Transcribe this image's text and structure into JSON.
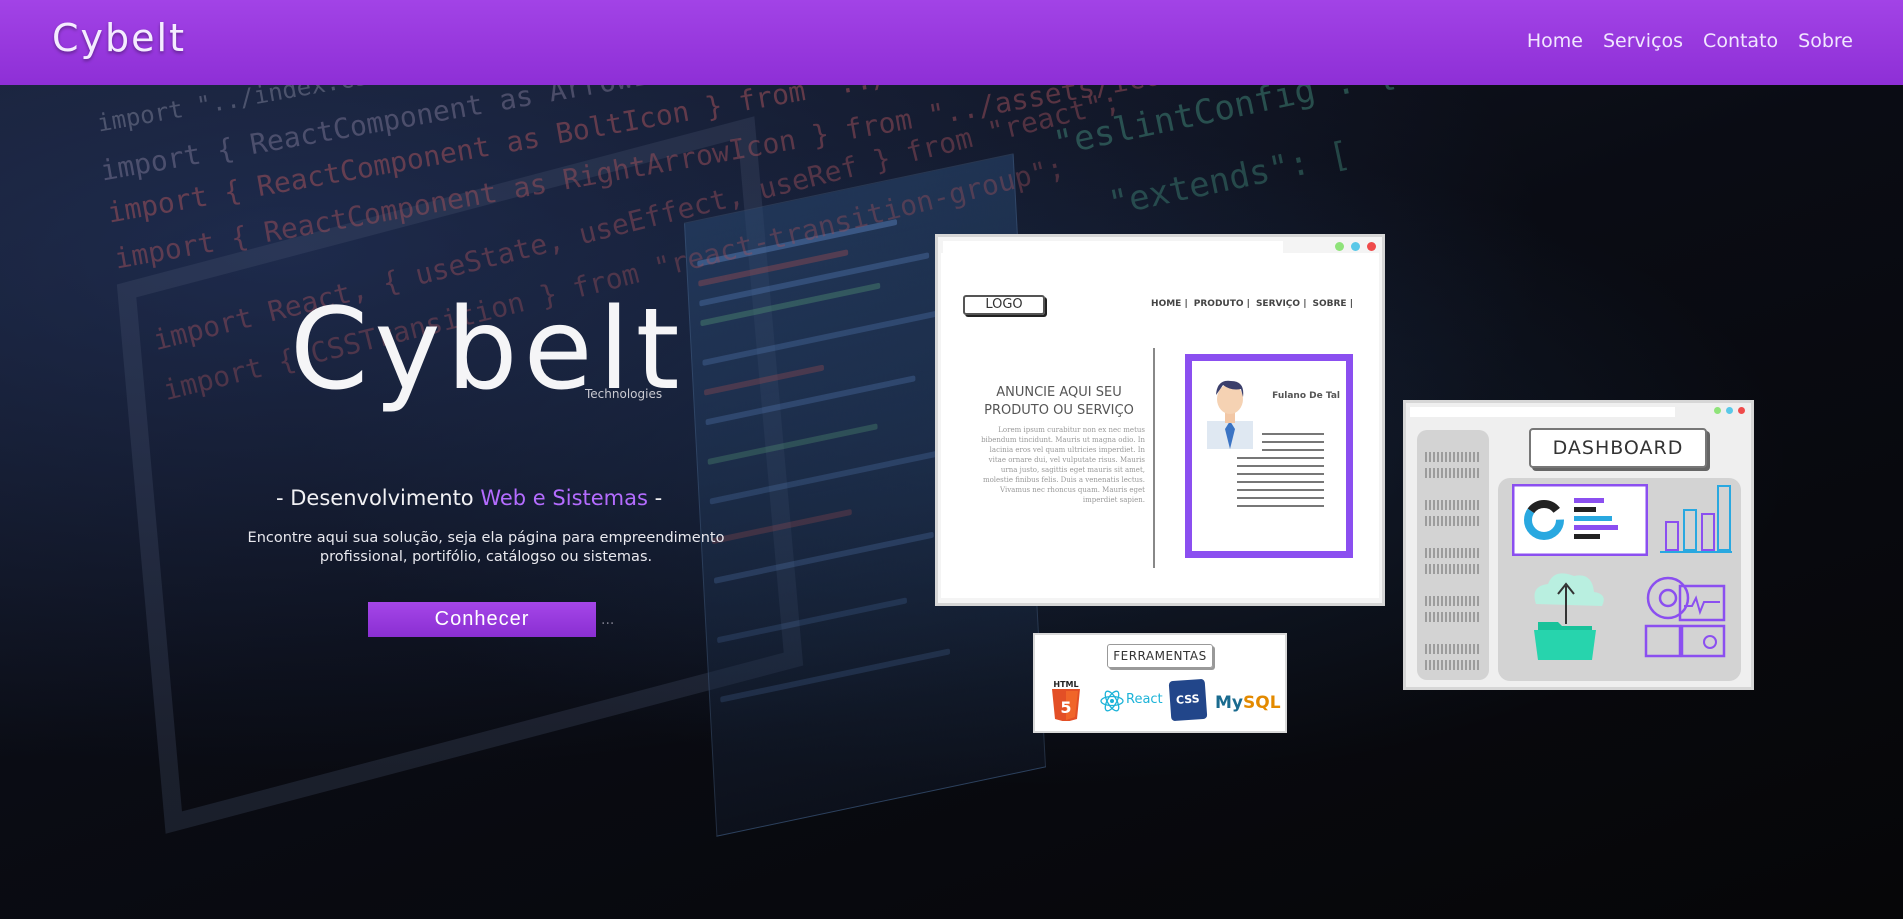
{
  "header": {
    "brand": "Cybelt",
    "nav": [
      "Home",
      "Serviços",
      "Contato",
      "Sobre"
    ]
  },
  "hero": {
    "title": "Cybelt",
    "subtitle": "Technologies",
    "tagline_prefix": "- Desenvolvimento ",
    "tagline_accent": "Web e Sistemas",
    "tagline_suffix": " -",
    "description": "Encontre aqui sua solução, seja ela página para empreendimento profissional, portifólio, catálogso ou sistemas.",
    "cta_label": "Conhecer",
    "cta_dots": "...",
    "background_code": [
      "import \"../index.css\";",
      "import { ReactComponent as ArrowIcon } from \"../assets/icons",
      "import { ReactComponent as BoltIcon } from \"../assets/",
      "import { ReactComponent as RightArrowIcon } from \"../assets/icon",
      "import React, { useState, useEffect, useRef } from \"react\";",
      "import { CSSTransition } from \"react-transition-group\";",
      "\"eslintConfig\": {",
      "\"extends\": ["
    ]
  },
  "website_mockup": {
    "logo": "LOGO",
    "nav": [
      "HOME |",
      "PRODUTO |",
      "SERVIÇO |",
      "SOBRE |"
    ],
    "headline": "ANUNCIE AQUI SEU PRODUTO OU SERVIÇO",
    "lorem": "Lorem ipsum curabitur non ex nec metus bibendum tincidunt. Mauris ut magna odio. In lacinia eros vel quam ultricies imperdiet. In vitae ornare dui, vel vulputate risus. Mauris urna justo, sagittis eget mauris sit amet, molestie finibus felis. Duis a venenatis lectus. Vivamus nec rhoncus quam. Mauris eget imperdiet sapien.",
    "card_name": "Fulano De Tal"
  },
  "tools": {
    "title": "FERRAMENTAS",
    "html5_label": "HTML",
    "html5_number": "5",
    "react_label": "React",
    "css_label": "CSS",
    "mysql_my": "My",
    "mysql_sql": "SQL"
  },
  "dashboard": {
    "title": "DASHBOARD"
  },
  "colors": {
    "header_purple": "#9b3ce2",
    "accent": "#b46cff",
    "cta": "#9a3ee0"
  }
}
